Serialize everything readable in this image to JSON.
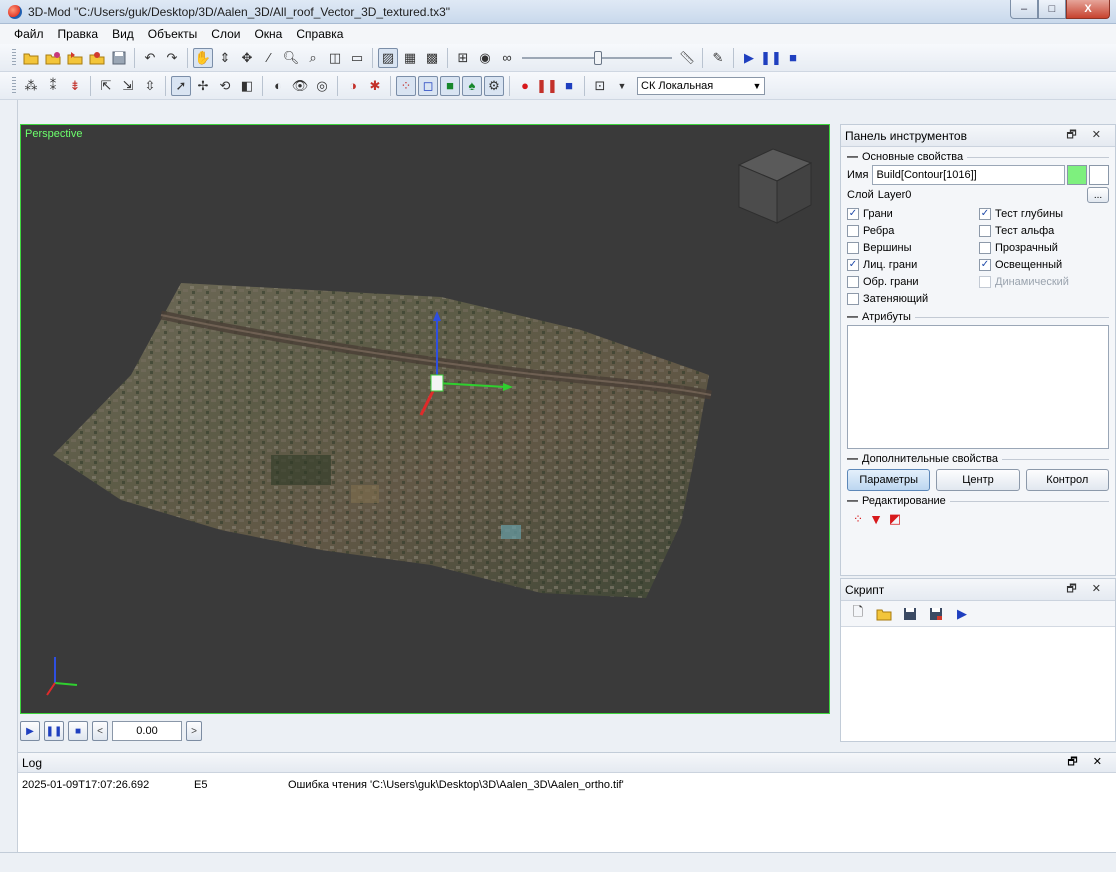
{
  "window": {
    "title": "3D-Mod \"C:/Users/guk/Desktop/3D/Aalen_3D/All_roof_Vector_3D_textured.tx3\"",
    "controls": [
      "–",
      "□",
      "X"
    ]
  },
  "menu": [
    "Файл",
    "Правка",
    "Вид",
    "Объекты",
    "Слои",
    "Окна",
    "Справка"
  ],
  "toolbar2": {
    "coord_system": "СК Локальная"
  },
  "viewport": {
    "label": "Perspective",
    "background": "#3a3a3a",
    "border": "#3cd43c"
  },
  "playback": {
    "time": "0.00"
  },
  "tools_panel": {
    "title": "Панель инструментов",
    "dock_controls": "🗗 ✕",
    "basic_section": "Основные свойства",
    "name_label": "Имя",
    "name_value": "Build[Contour[1016]]",
    "layer_label": "Слой",
    "layer_value": "Layer0",
    "layer_button": "...",
    "color": "#7ef07e",
    "checkboxes": [
      {
        "label": "Грани",
        "checked": true
      },
      {
        "label": "Тест глубины",
        "checked": true
      },
      {
        "label": "Ребра",
        "checked": false
      },
      {
        "label": "Тест альфа",
        "checked": false
      },
      {
        "label": "Вершины",
        "checked": false
      },
      {
        "label": "Прозрачный",
        "checked": false
      },
      {
        "label": "Лиц. грани",
        "checked": true
      },
      {
        "label": "Освещенный",
        "checked": true
      },
      {
        "label": "Обр. грани",
        "checked": false
      },
      {
        "label": "Динамический",
        "checked": false,
        "disabled": true
      },
      {
        "label": "Затеняющий",
        "checked": false
      }
    ],
    "attributes_section": "Атрибуты",
    "extra_section": "Дополнительные свойства",
    "buttons": [
      "Параметры",
      "Центр",
      "Контрол"
    ],
    "edit_section": "Редактирование"
  },
  "script_panel": {
    "title": "Скрипт",
    "dock_controls": "🗗 ✕"
  },
  "log": {
    "title": "Log",
    "dock_controls": "🗗 ✕",
    "entries": [
      {
        "time": "2025-01-09T17:07:26.692",
        "code": "E5",
        "message": "Ошибка чтения 'C:\\Users\\guk\\Desktop\\3D\\Aalen_3D\\Aalen_ortho.tif'"
      }
    ]
  }
}
